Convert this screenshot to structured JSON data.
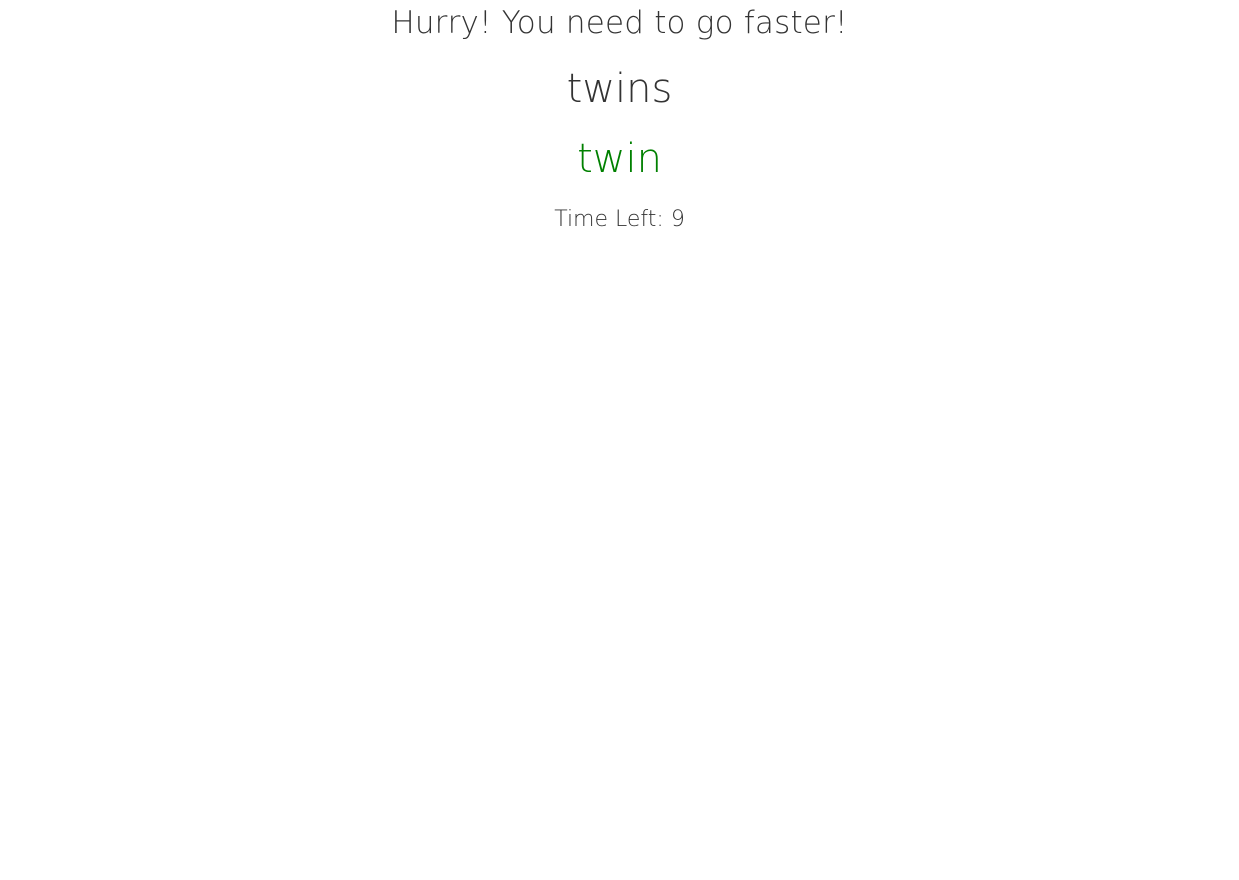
{
  "game": {
    "message": "Hurry! You need to go faster!",
    "target_word": "twins",
    "typed_word": "twin",
    "time_left_label": "Time Left: 9"
  },
  "colors": {
    "text": "#333333",
    "typed_correct": "#008000",
    "background": "#ffffff"
  }
}
